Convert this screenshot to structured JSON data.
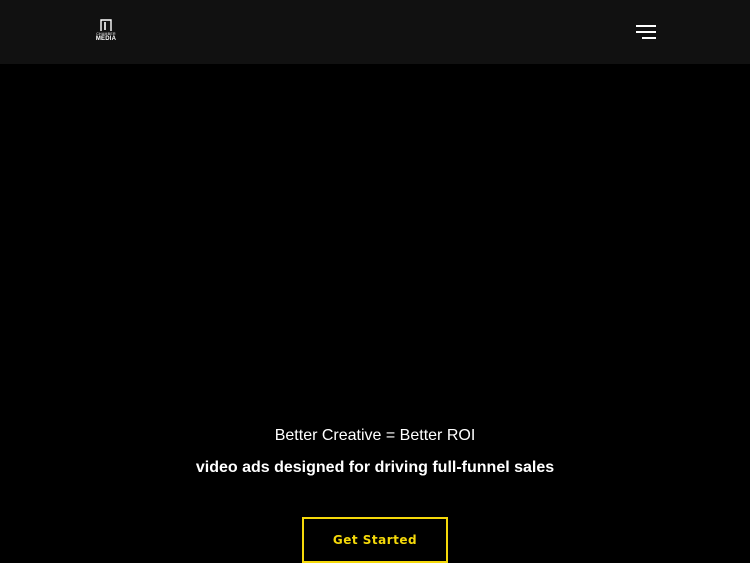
{
  "header": {
    "logo": {
      "line1": "CHAMBER",
      "line2": "MEDIA"
    },
    "menu_icon": "hamburger-menu-icon"
  },
  "hero": {
    "title": "Better Creative = Better ROI",
    "subtitle": "video ads designed for driving full-funnel sales",
    "cta_label": "Get Started"
  },
  "colors": {
    "background": "#000000",
    "header_background": "#111111",
    "text": "#ffffff",
    "accent": "#f5d90a"
  }
}
